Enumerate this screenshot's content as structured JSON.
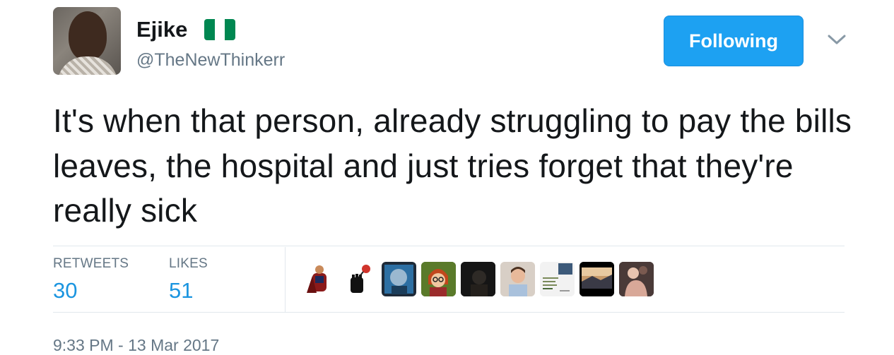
{
  "user": {
    "name": "Ejike",
    "handle": "@TheNewThinkerr",
    "flag_icon": "nigeria-flag-icon"
  },
  "follow_button": {
    "label": "Following"
  },
  "menu": {
    "icon": "chevron-down-icon"
  },
  "tweet": {
    "text": "It's when that person, already struggling to pay the bills leaves, the hospital and just tries forget that they're really sick"
  },
  "stats": {
    "retweets_label": "RETWEETS",
    "retweets_count": "30",
    "likes_label": "LIKES",
    "likes_count": "51"
  },
  "likers": [
    {
      "icon": "liker-avatar-1"
    },
    {
      "icon": "liker-avatar-2"
    },
    {
      "icon": "liker-avatar-3"
    },
    {
      "icon": "liker-avatar-4"
    },
    {
      "icon": "liker-avatar-5"
    },
    {
      "icon": "liker-avatar-6"
    },
    {
      "icon": "liker-avatar-7"
    },
    {
      "icon": "liker-avatar-8"
    },
    {
      "icon": "liker-avatar-9"
    }
  ],
  "timestamp": "9:33 PM - 13 Mar 2017",
  "colors": {
    "follow_button_bg": "#1da1f2",
    "stat_value": "#1b95e0",
    "secondary_text": "#657786",
    "flag_green": "#008751",
    "flag_white": "#ffffff"
  }
}
